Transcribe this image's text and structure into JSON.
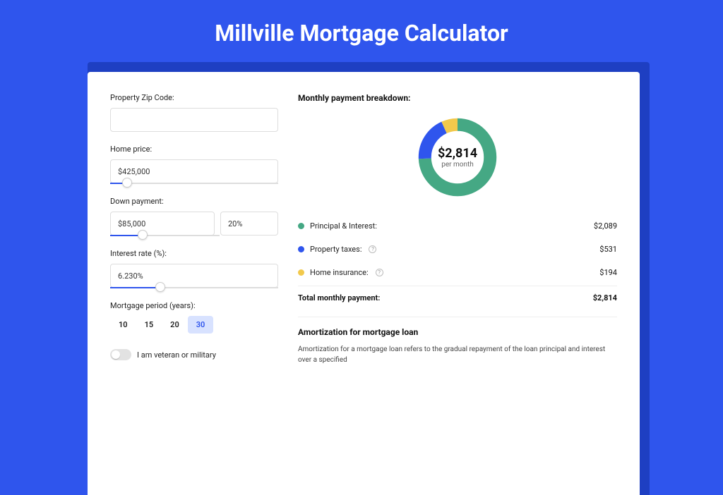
{
  "title": "Millville Mortgage Calculator",
  "form": {
    "zip": {
      "label": "Property Zip Code:",
      "value": ""
    },
    "price": {
      "label": "Home price:",
      "value": "$425,000",
      "slider_pct": 10
    },
    "down": {
      "label": "Down payment:",
      "amount": "$85,000",
      "percent": "20%",
      "slider_pct": 20
    },
    "rate": {
      "label": "Interest rate (%):",
      "value": "6.230%",
      "slider_pct": 30
    },
    "period": {
      "label": "Mortgage period (years):",
      "options": [
        "10",
        "15",
        "20",
        "30"
      ],
      "active": "30"
    },
    "veteran_label": "I am veteran or military"
  },
  "breakdown": {
    "title": "Monthly payment breakdown:",
    "donut": {
      "amount": "$2,814",
      "sub": "per month"
    },
    "items": [
      {
        "label": "Principal & Interest:",
        "value": "$2,089",
        "color": "#45a884",
        "help": false
      },
      {
        "label": "Property taxes:",
        "value": "$531",
        "color": "#2f55ed",
        "help": true
      },
      {
        "label": "Home insurance:",
        "value": "$194",
        "color": "#f2c94c",
        "help": true
      }
    ],
    "total_label": "Total monthly payment:",
    "total_value": "$2,814"
  },
  "chart_data": {
    "type": "pie",
    "title": "Monthly payment breakdown",
    "series": [
      {
        "name": "Principal & Interest",
        "value": 2089,
        "color": "#45a884"
      },
      {
        "name": "Property taxes",
        "value": 531,
        "color": "#2f55ed"
      },
      {
        "name": "Home insurance",
        "value": 194,
        "color": "#f2c94c"
      }
    ],
    "total": 2814
  },
  "amortization": {
    "title": "Amortization for mortgage loan",
    "text": "Amortization for a mortgage loan refers to the gradual repayment of the loan principal and interest over a specified"
  }
}
